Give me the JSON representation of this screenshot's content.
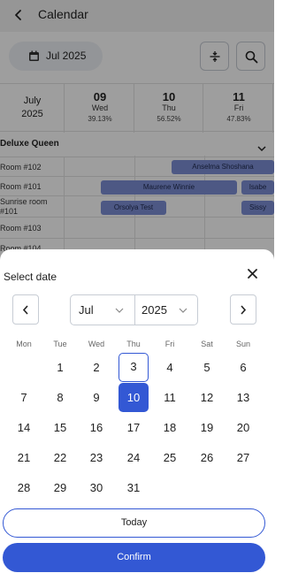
{
  "header": {
    "title": "Calendar"
  },
  "controls": {
    "date_label": "Jul 2025"
  },
  "grid": {
    "month": "July",
    "year": "2025",
    "days": [
      {
        "num": "09",
        "weekday": "Wed",
        "pct": "39.13%"
      },
      {
        "num": "10",
        "weekday": "Thu",
        "pct": "56.52%"
      },
      {
        "num": "11",
        "weekday": "Fri",
        "pct": "47.83%"
      }
    ],
    "room_type": "Deluxe Queen",
    "rooms": [
      "Room #102",
      "Room #101",
      "Sunrise room #101",
      "Room #103",
      "Room #104"
    ],
    "bookings": [
      "Anselma Shoshana",
      "Maurene Winnie",
      "Isabe",
      "Orsolya Test",
      "Sissy"
    ]
  },
  "picker": {
    "title": "Select date",
    "month_value": "Jul",
    "year_value": "2025",
    "weekdays": [
      "Mon",
      "Tue",
      "Wed",
      "Thu",
      "Fri",
      "Sat",
      "Sun"
    ],
    "days": [
      "1",
      "2",
      "3",
      "4",
      "5",
      "6",
      "7",
      "8",
      "9",
      "10",
      "11",
      "12",
      "13",
      "14",
      "15",
      "16",
      "17",
      "18",
      "19",
      "20",
      "21",
      "22",
      "23",
      "24",
      "25",
      "26",
      "27",
      "28",
      "29",
      "30",
      "31"
    ],
    "today_day": "3",
    "selected_day": "10",
    "today_label": "Today",
    "confirm_label": "Confirm"
  },
  "colors": {
    "accent": "#3358d4",
    "booking": "#7d8fd6"
  }
}
